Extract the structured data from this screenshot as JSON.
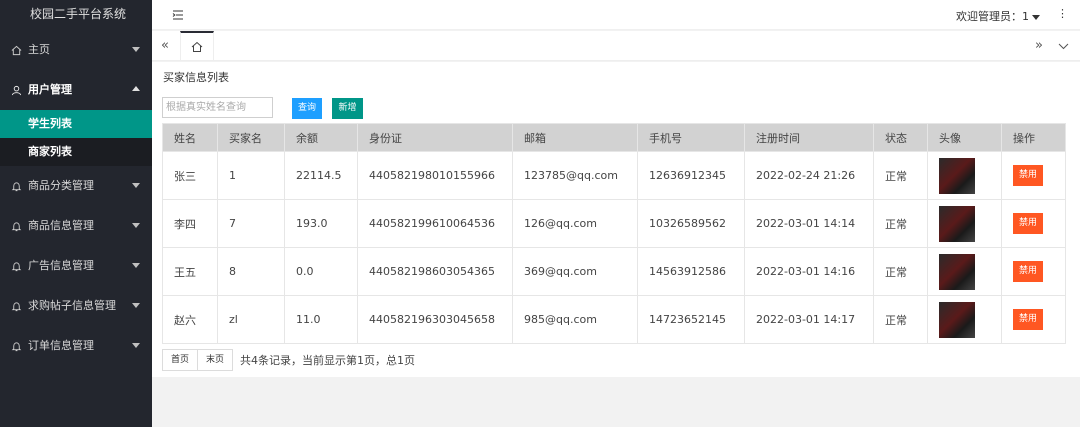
{
  "app": {
    "title": "校园二手平台系统"
  },
  "sidebar": {
    "items": [
      {
        "label": "主页"
      },
      {
        "label": "用户管理"
      },
      {
        "label": "商品分类管理"
      },
      {
        "label": "商品信息管理"
      },
      {
        "label": "广告信息管理"
      },
      {
        "label": "求购帖子信息管理"
      },
      {
        "label": "订单信息管理"
      }
    ],
    "sub_items": [
      {
        "label": "学生列表"
      },
      {
        "label": "商家列表"
      }
    ]
  },
  "header": {
    "admin_label": "欢迎管理员：1",
    "more": "⋮"
  },
  "tabs": {
    "left": "«",
    "right": "»"
  },
  "main": {
    "title": "买家信息列表",
    "search_placeholder": "根据真实姓名查询",
    "query_label": "查询",
    "add_label": "新增",
    "columns": [
      "姓名",
      "买家名",
      "余额",
      "身份证",
      "邮箱",
      "手机号",
      "注册时间",
      "状态",
      "头像",
      "操作"
    ],
    "rows": [
      {
        "name": "张三",
        "buyer": "1",
        "balance": "22114.5",
        "id_card": "440582198010155966",
        "email": "123785@qq.com",
        "phone": "12636912345",
        "registered": "2022-02-24 21:26",
        "status": "正常",
        "action": "禁用"
      },
      {
        "name": "李四",
        "buyer": "7",
        "balance": "193.0",
        "id_card": "440582199610064536",
        "email": "126@qq.com",
        "phone": "10326589562",
        "registered": "2022-03-01 14:14",
        "status": "正常",
        "action": "禁用"
      },
      {
        "name": "王五",
        "buyer": "8",
        "balance": "0.0",
        "id_card": "440582198603054365",
        "email": "369@qq.com",
        "phone": "14563912586",
        "registered": "2022-03-01 14:16",
        "status": "正常",
        "action": "禁用"
      },
      {
        "name": "赵六",
        "buyer": "zl",
        "balance": "11.0",
        "id_card": "440582196303045658",
        "email": "985@qq.com",
        "phone": "14723652145",
        "registered": "2022-03-01 14:17",
        "status": "正常",
        "action": "禁用"
      }
    ],
    "pager": {
      "first": "首页",
      "last": "末页",
      "info": "共4条记录，当前显示第1页，总1页"
    }
  }
}
